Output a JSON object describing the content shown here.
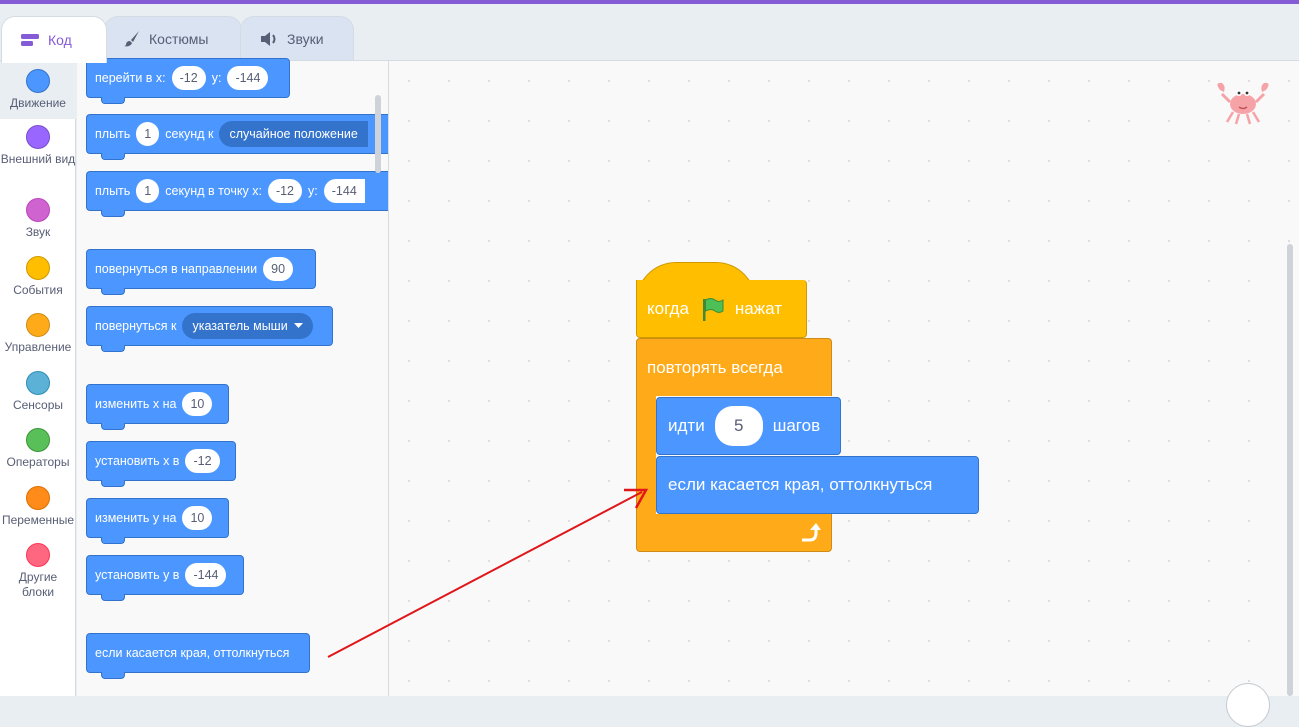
{
  "colors": {
    "accent": "#855cd6",
    "motion": "#4c97ff",
    "events": "#ffbf00",
    "control": "#ffab19",
    "annotation_arrow": "#e0161b"
  },
  "tabs": [
    {
      "label": "Код",
      "icon": "code-icon",
      "active": true
    },
    {
      "label": "Костюмы",
      "icon": "brush-icon",
      "active": false
    },
    {
      "label": "Звуки",
      "icon": "speaker-icon",
      "active": false
    }
  ],
  "categories": [
    {
      "label": "Движение",
      "color": "#4c97ff",
      "selected": true
    },
    {
      "label": "Внешний вид",
      "color": "#9966ff"
    },
    {
      "label": "Звук",
      "color": "#cf63cf"
    },
    {
      "label": "События",
      "color": "#ffbf00"
    },
    {
      "label": "Управление",
      "color": "#ffab19"
    },
    {
      "label": "Сенсоры",
      "color": "#5cb1d6"
    },
    {
      "label": "Операторы",
      "color": "#59c059"
    },
    {
      "label": "Переменные",
      "color": "#ff8c1a"
    },
    {
      "label": "Другие блоки",
      "color": "#ff6680"
    }
  ],
  "palette": {
    "goto_xy": {
      "text": "перейти в x:",
      "x": "-12",
      "y_label": "y:",
      "y": "-144"
    },
    "glide_random": {
      "text1": "плыть",
      "secs": "1",
      "text2": "секунд к",
      "target": "случайное положение"
    },
    "glide_xy": {
      "text1": "плыть",
      "secs": "1",
      "text2": "секунд в точку x:",
      "x": "-12",
      "y_label": "y:",
      "y": "-144"
    },
    "point_dir": {
      "text": "повернуться в направлении",
      "value": "90"
    },
    "point_towards": {
      "text": "повернуться к",
      "target": "указатель мыши"
    },
    "change_x": {
      "text": "изменить x на",
      "value": "10"
    },
    "set_x": {
      "text": "установить x в",
      "value": "-12"
    },
    "change_y": {
      "text": "изменить y на",
      "value": "10"
    },
    "set_y": {
      "text": "установить y в",
      "value": "-144"
    },
    "bounce": {
      "text": "если касается края, оттолкнуться"
    }
  },
  "script": {
    "hat": {
      "text1": "когда",
      "icon": "green-flag-icon",
      "text2": "нажат"
    },
    "forever": {
      "label": "повторять всегда",
      "icon": "loop-arrow-icon"
    },
    "move": {
      "text1": "идти",
      "steps": "5",
      "text2": "шагов"
    },
    "bounce": {
      "text": "если касается края, оттолкнуться"
    }
  },
  "sprite_icon": "crab-icon"
}
